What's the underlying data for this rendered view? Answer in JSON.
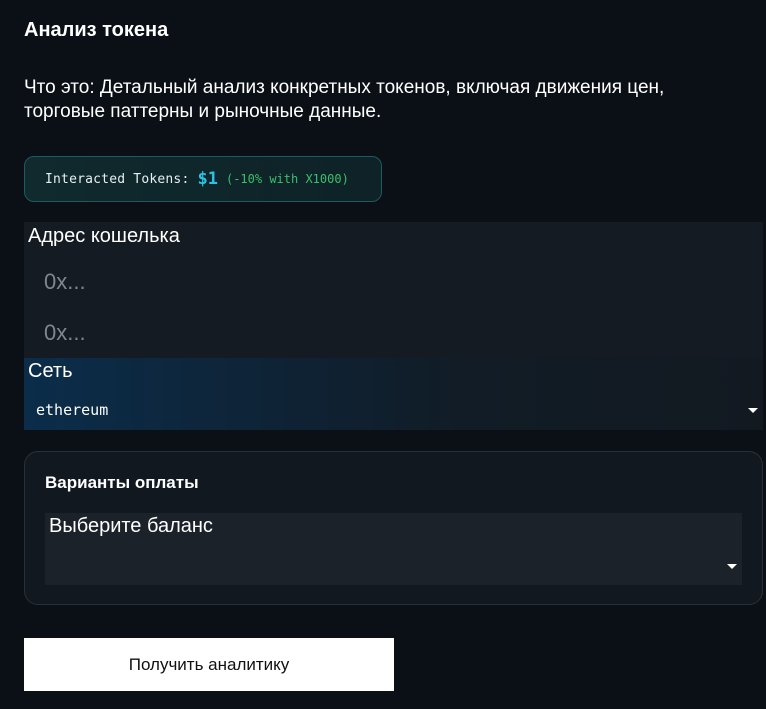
{
  "page": {
    "title": "Анализ токена",
    "description": "Что это: Детальный анализ конкретных токенов, включая движения цен, торговые паттерны и рыночные данные."
  },
  "badge": {
    "label": "Interacted Tokens:",
    "value": "$1",
    "bonus": "(-10% with X1000)"
  },
  "wallet": {
    "label": "Адрес кошелька",
    "inputs": [
      {
        "placeholder": "0x..."
      },
      {
        "placeholder": "0x..."
      }
    ]
  },
  "network": {
    "label": "Сеть",
    "selected": "ethereum"
  },
  "payment": {
    "title": "Варианты оплаты",
    "balance_label": "Выберите баланс"
  },
  "actions": {
    "submit_label": "Получить аналитику"
  },
  "colors": {
    "background": "#0b1016",
    "accent_value": "#2ac3e6",
    "bonus_green": "#3bbf6a",
    "badge_border": "#1e5a5e"
  },
  "icons": {
    "network_dropdown": "caret-down-icon",
    "balance_dropdown": "caret-down-icon"
  }
}
